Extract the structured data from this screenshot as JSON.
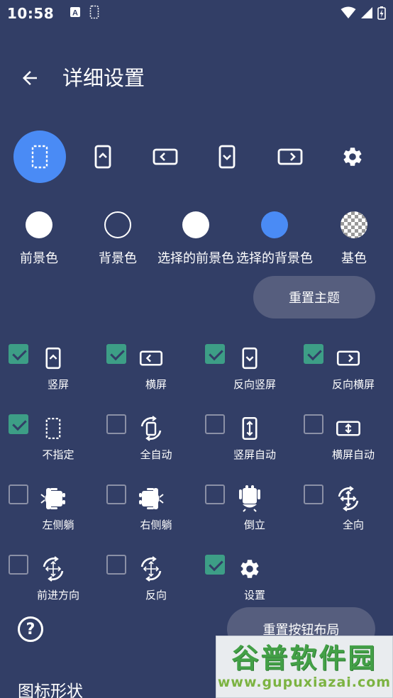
{
  "status_bar": {
    "time": "10:58"
  },
  "header": {
    "title": "详细设置"
  },
  "modes": [
    {
      "name": "unspecified",
      "icon": "dotted-phone-icon",
      "selected": true
    },
    {
      "name": "portrait",
      "icon": "portrait-icon",
      "selected": false
    },
    {
      "name": "landscape",
      "icon": "landscape-icon",
      "selected": false
    },
    {
      "name": "reverse-portrait",
      "icon": "reverse-portrait-icon",
      "selected": false
    },
    {
      "name": "reverse-landscape",
      "icon": "reverse-landscape-icon",
      "selected": false
    },
    {
      "name": "settings",
      "icon": "gear-icon",
      "selected": false
    }
  ],
  "colors": [
    {
      "label": "前景色",
      "swatch": "#ffffff"
    },
    {
      "label": "背景色",
      "swatch": "outline"
    },
    {
      "label": "选择的前景色",
      "swatch": "#ffffff"
    },
    {
      "label": "选择的背景色",
      "swatch": "#4a8bf5"
    },
    {
      "label": "基色",
      "swatch": "checker"
    }
  ],
  "reset_theme_button": "重置主题",
  "options": [
    {
      "label": "竖屏",
      "icon": "portrait-icon",
      "checked": true
    },
    {
      "label": "横屏",
      "icon": "landscape-icon",
      "checked": true
    },
    {
      "label": "反向竖屏",
      "icon": "reverse-portrait-icon",
      "checked": true
    },
    {
      "label": "反向横屏",
      "icon": "reverse-landscape-icon",
      "checked": true
    },
    {
      "label": "不指定",
      "icon": "dotted-phone-icon",
      "checked": true
    },
    {
      "label": "全自动",
      "icon": "auto-rotate-icon",
      "checked": false
    },
    {
      "label": "竖屏自动",
      "icon": "portrait-auto-icon",
      "checked": false
    },
    {
      "label": "横屏自动",
      "icon": "landscape-auto-icon",
      "checked": false
    },
    {
      "label": "左侧躺",
      "icon": "android-left-icon",
      "checked": false
    },
    {
      "label": "右侧躺",
      "icon": "android-right-icon",
      "checked": false
    },
    {
      "label": "倒立",
      "icon": "android-upside-icon",
      "checked": false
    },
    {
      "label": "全向",
      "icon": "all-directions-icon",
      "checked": false
    },
    {
      "label": "前进方向",
      "icon": "forward-direction-icon",
      "checked": false
    },
    {
      "label": "反向",
      "icon": "reverse-direction-icon",
      "checked": false
    },
    {
      "label": "设置",
      "icon": "gear-icon",
      "checked": true
    }
  ],
  "reset_layout_button": "重置按钮布局",
  "help_label": "?",
  "section_title": "图标形状",
  "watermark": {
    "line1": "谷普软件园",
    "line2": "www.gupuxiazai.com"
  },
  "colors_theme": {
    "background": "#323e66",
    "accent": "#4a8bf5",
    "check": "#3d9e86",
    "pill": "#565e7e"
  }
}
